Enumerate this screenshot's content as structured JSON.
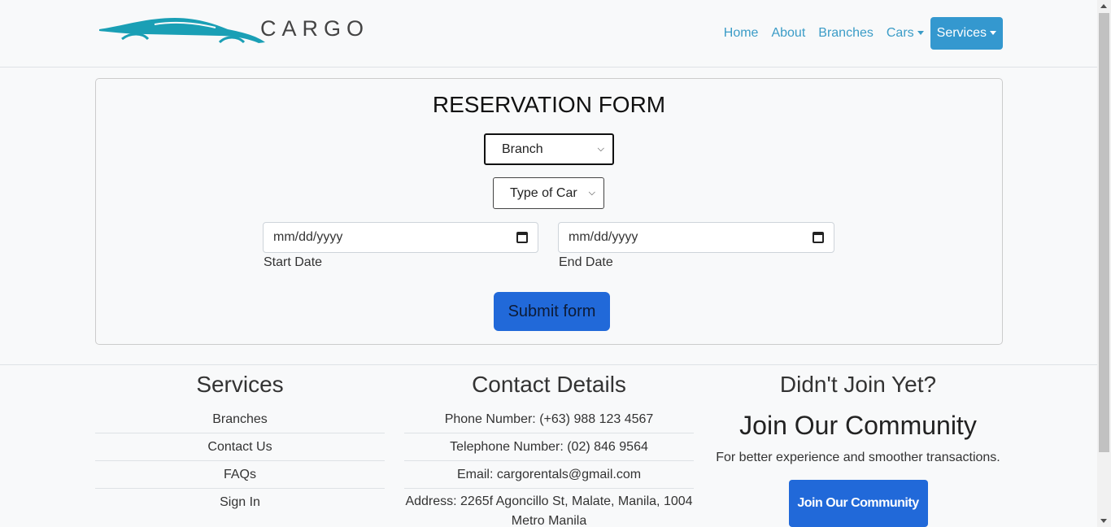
{
  "brand": {
    "name": "CarGo",
    "logo_text": "CARGO",
    "logo_icon": "car-silhouette",
    "accent": "#1a9fb5"
  },
  "nav": {
    "home": "Home",
    "about": "About",
    "branches": "Branches",
    "cars": "Cars",
    "services": "Services"
  },
  "form": {
    "title": "RESERVATION FORM",
    "branch_select": "Branch",
    "car_select": "Type of Car",
    "start_date_value": "mm/dd/yyyy",
    "end_date_value": "mm/dd/yyyy",
    "start_label": "Start Date",
    "end_label": "End Date",
    "submit": "Submit form"
  },
  "footer": {
    "services": {
      "title": "Services",
      "items": [
        "Branches",
        "Contact Us",
        "FAQs",
        "Sign In"
      ]
    },
    "contact": {
      "title": "Contact Details",
      "items": [
        "Phone Number: (+63) 988 123 4567",
        "Telephone Number: (02) 846 9564",
        "Email: cargorentals@gmail.com",
        "Address: 2265f Agoncillo St, Malate, Manila, 1004 Metro Manila"
      ]
    },
    "join": {
      "heading": "Didn't Join Yet?",
      "big": "Join Our Community",
      "sub": "For better experience and smoother transactions.",
      "button": "Join Our Community"
    }
  },
  "colors": {
    "nav_link": "#3b9cc7",
    "services_btn": "#3498cf",
    "primary_btn": "#2169d9"
  }
}
